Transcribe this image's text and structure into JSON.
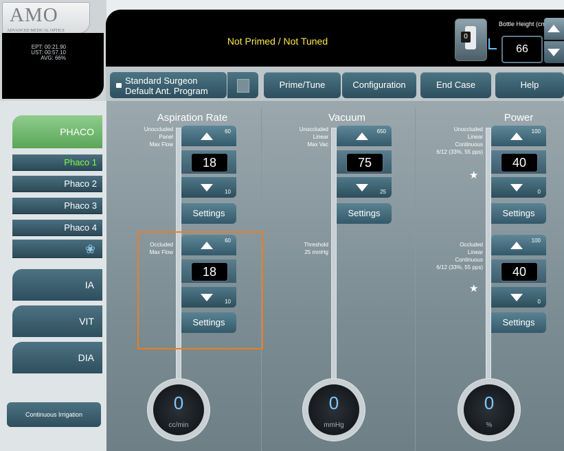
{
  "logo": {
    "brand": "AMO",
    "subtitle": "ADVANCED MEDICAL OPTICS"
  },
  "timers": {
    "ept": "EPT: 00:21.90",
    "ust": "UST: 00:57.10",
    "avg": "AVG: 66%"
  },
  "status": {
    "text": "Not Primed / Not Tuned"
  },
  "bottle": {
    "label": "Bottle Height (cm)",
    "value": "66",
    "icon_value": "0"
  },
  "program": {
    "line1": "Standard Surgeon",
    "line2": "Default Ant. Program"
  },
  "nav": {
    "prime_tune": "Prime/Tune",
    "configuration": "Configuration",
    "end_case": "End Case",
    "help": "Help"
  },
  "sidebar": {
    "phaco": "PHACO",
    "phaco_items": [
      "Phaco 1",
      "Phaco 2",
      "Phaco 3",
      "Phaco 4"
    ],
    "ia": "IA",
    "vit": "VIT",
    "dia": "DIA",
    "continuous_irrigation": "Continuous Irrigation"
  },
  "aspiration": {
    "title": "Aspiration Rate",
    "top_labels": [
      "Unoccluded",
      "Panel",
      "Max Flow"
    ],
    "top_value": "18",
    "top_max": "60",
    "top_min": "10",
    "bottom_labels": [
      "Occluded",
      "Max Flow"
    ],
    "bottom_value": "18",
    "bottom_max": "60",
    "bottom_min": "10",
    "settings": "Settings",
    "gauge_value": "0",
    "gauge_unit": "cc/min"
  },
  "vacuum": {
    "title": "Vacuum",
    "top_labels": [
      "Unoccluded",
      "Linear",
      "Max Vac"
    ],
    "top_value": "75",
    "top_max": "650",
    "top_min": "25",
    "bottom_labels": [
      "Threshold",
      "25 mmHg"
    ],
    "settings": "Settings",
    "gauge_value": "0",
    "gauge_unit": "mmHg"
  },
  "power": {
    "title": "Power",
    "top_labels": [
      "Unoccluded",
      "Linear",
      "Continuous",
      "6/12 (33%, 55 pps)"
    ],
    "top_value": "40",
    "top_max": "100",
    "top_min": "0",
    "bottom_labels": [
      "Occluded",
      "Linear",
      "Continuous",
      "6/12 (33%, 55 pps)"
    ],
    "bottom_value": "40",
    "bottom_max": "100",
    "bottom_min": "0",
    "settings": "Settings",
    "gauge_value": "0",
    "gauge_unit": "%"
  },
  "colors": {
    "status_text": "#ffee22",
    "active_item": "#7dff3a",
    "highlight": "#f07d1a",
    "phaco_green": "#6fb86c"
  }
}
